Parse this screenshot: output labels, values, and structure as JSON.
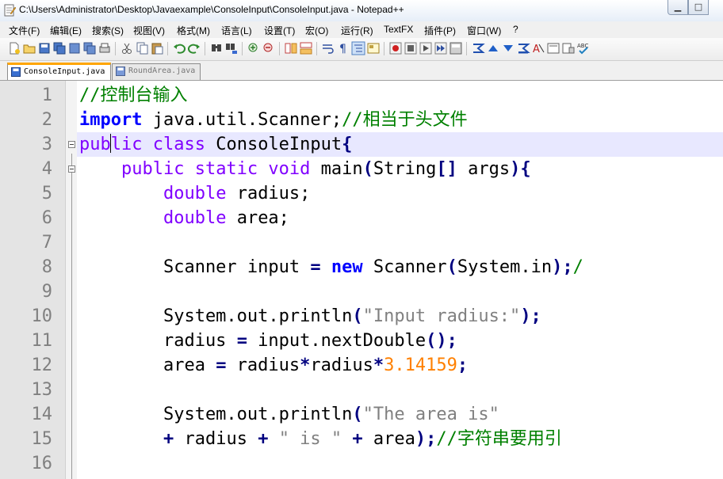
{
  "window": {
    "title": "C:\\Users\\Administrator\\Desktop\\Javaexample\\ConsoleInput\\ConsoleInput.java - Notepad++",
    "app_icon": "notepad-icon",
    "minimize_glyph": "▁",
    "maximize_glyph": "□"
  },
  "menu": [
    "文件(F)",
    "编辑(E)",
    "搜索(S)",
    "视图(V)",
    "格式(M)",
    "语言(L)",
    "设置(T)",
    "宏(O)",
    "运行(R)",
    "TextFX",
    "插件(P)",
    "窗口(W)",
    "?"
  ],
  "toolbar": [
    "new-file-icon",
    "open-file-icon",
    "save-icon",
    "save-all-icon",
    "close-icon",
    "close-all-icon",
    "print-icon",
    "cut-icon",
    "copy-icon",
    "paste-icon",
    "undo-icon",
    "redo-icon",
    "find-icon",
    "replace-icon",
    "zoom-in-icon",
    "zoom-out-icon",
    "sync-vertical-icon",
    "sync-horizontal-icon",
    "word-wrap-icon",
    "show-all-chars-icon",
    "indent-guide-icon",
    "doc-map-icon",
    "record-macro-icon",
    "stop-macro-icon",
    "play-macro-icon",
    "run-macro-multiple-icon",
    "save-macro-icon",
    "textfx-1-icon",
    "textfx-2-icon",
    "textfx-3-icon",
    "textfx-4-icon",
    "textfx-5-icon",
    "textfx-6-icon",
    "textfx-7-icon",
    "spellcheck-icon"
  ],
  "tabs": [
    {
      "label": "ConsoleInput.java",
      "active": true,
      "icon": "saved-file-icon"
    },
    {
      "label": "RoundArea.java",
      "active": false,
      "icon": "saved-file-icon"
    }
  ],
  "editor": {
    "line_numbers": [
      "1",
      "2",
      "3",
      "4",
      "5",
      "6",
      "7",
      "8",
      "9",
      "10",
      "11",
      "12",
      "13",
      "14",
      "15",
      "16"
    ],
    "current_line": 3,
    "lines": [
      {
        "n": 1,
        "tokens": [
          {
            "t": "//控制台输入",
            "c": "cm"
          }
        ]
      },
      {
        "n": 2,
        "tokens": [
          {
            "t": "import",
            "c": "kwb"
          },
          {
            "t": " java.util.Scanner;",
            "c": ""
          },
          {
            "t": "//相当于头文件",
            "c": "cm"
          }
        ]
      },
      {
        "n": 3,
        "tokens": [
          {
            "t": "pub",
            "c": "kw"
          },
          {
            "t": "CARET",
            "c": "caret"
          },
          {
            "t": "lic class",
            "c": "kw"
          },
          {
            "t": " ConsoleInput",
            "c": ""
          },
          {
            "t": "{",
            "c": "op"
          }
        ]
      },
      {
        "n": 4,
        "tokens": [
          {
            "t": "    ",
            "c": ""
          },
          {
            "t": "public static void",
            "c": "kw"
          },
          {
            "t": " main",
            "c": ""
          },
          {
            "t": "(",
            "c": "op"
          },
          {
            "t": "String",
            "c": ""
          },
          {
            "t": "[]",
            "c": "op"
          },
          {
            "t": " args",
            "c": ""
          },
          {
            "t": "){",
            "c": "op"
          }
        ]
      },
      {
        "n": 5,
        "tokens": [
          {
            "t": "        ",
            "c": ""
          },
          {
            "t": "double",
            "c": "kw"
          },
          {
            "t": " radius;",
            "c": ""
          }
        ]
      },
      {
        "n": 6,
        "tokens": [
          {
            "t": "        ",
            "c": ""
          },
          {
            "t": "double",
            "c": "kw"
          },
          {
            "t": " area;",
            "c": ""
          }
        ]
      },
      {
        "n": 7,
        "tokens": []
      },
      {
        "n": 8,
        "tokens": [
          {
            "t": "        Scanner input ",
            "c": ""
          },
          {
            "t": "=",
            "c": "op"
          },
          {
            "t": " ",
            "c": ""
          },
          {
            "t": "new",
            "c": "kwb"
          },
          {
            "t": " Scanner",
            "c": ""
          },
          {
            "t": "(",
            "c": "op"
          },
          {
            "t": "System.in",
            "c": ""
          },
          {
            "t": ");",
            "c": "op"
          },
          {
            "t": "/",
            "c": "cm"
          }
        ]
      },
      {
        "n": 9,
        "tokens": []
      },
      {
        "n": 10,
        "tokens": [
          {
            "t": "        System.out.println",
            "c": ""
          },
          {
            "t": "(",
            "c": "op"
          },
          {
            "t": "\"Input radius:\"",
            "c": "st"
          },
          {
            "t": ");",
            "c": "op"
          }
        ]
      },
      {
        "n": 11,
        "tokens": [
          {
            "t": "        radius ",
            "c": ""
          },
          {
            "t": "=",
            "c": "op"
          },
          {
            "t": " input.nextDouble",
            "c": ""
          },
          {
            "t": "();",
            "c": "op"
          }
        ]
      },
      {
        "n": 12,
        "tokens": [
          {
            "t": "        area ",
            "c": ""
          },
          {
            "t": "=",
            "c": "op"
          },
          {
            "t": " radius",
            "c": ""
          },
          {
            "t": "*",
            "c": "op"
          },
          {
            "t": "radius",
            "c": ""
          },
          {
            "t": "*",
            "c": "op"
          },
          {
            "t": "3.14159",
            "c": "nm"
          },
          {
            "t": ";",
            "c": "op"
          }
        ]
      },
      {
        "n": 13,
        "tokens": []
      },
      {
        "n": 14,
        "tokens": [
          {
            "t": "        System.out.println",
            "c": ""
          },
          {
            "t": "(",
            "c": "op"
          },
          {
            "t": "\"The area is\"",
            "c": "st"
          }
        ]
      },
      {
        "n": 15,
        "tokens": [
          {
            "t": "        ",
            "c": ""
          },
          {
            "t": "+",
            "c": "op"
          },
          {
            "t": " radius ",
            "c": ""
          },
          {
            "t": "+",
            "c": "op"
          },
          {
            "t": " ",
            "c": ""
          },
          {
            "t": "\" is \"",
            "c": "st"
          },
          {
            "t": " ",
            "c": ""
          },
          {
            "t": "+",
            "c": "op"
          },
          {
            "t": " area",
            "c": ""
          },
          {
            "t": ");",
            "c": "op"
          },
          {
            "t": "//字符串要用引",
            "c": "cm"
          }
        ]
      },
      {
        "n": 16,
        "tokens": []
      }
    ]
  },
  "colors": {
    "keyword": "#8000ff",
    "keyword_bold": "#0000ff",
    "comment": "#008000",
    "operator": "#000080",
    "string": "#808080",
    "number": "#ff8000",
    "current_line_bg": "#e8e8ff",
    "active_tab_accent": "#ffa500"
  }
}
